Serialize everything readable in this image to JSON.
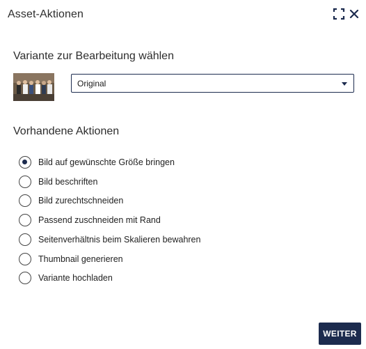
{
  "dialog": {
    "title": "Asset-Aktionen",
    "expand_icon": "expand-icon",
    "close_icon": "close-icon"
  },
  "variant_section": {
    "title": "Variante zur Bearbeitung wählen",
    "selected": "Original",
    "thumbnail_icon": "photo-thumbnail"
  },
  "actions_section": {
    "title": "Vorhandene Aktionen",
    "options": [
      {
        "label": "Bild auf gewünschte Größe bringen",
        "selected": true
      },
      {
        "label": "Bild beschriften",
        "selected": false
      },
      {
        "label": "Bild zurechtschneiden",
        "selected": false
      },
      {
        "label": "Passend zuschneiden mit Rand",
        "selected": false
      },
      {
        "label": "Seitenverhältnis beim Skalieren bewahren",
        "selected": false
      },
      {
        "label": "Thumbnail generieren",
        "selected": false
      },
      {
        "label": "Variante hochladen",
        "selected": false
      }
    ]
  },
  "footer": {
    "next_label": "WEITER"
  },
  "colors": {
    "accent": "#1c2b4e",
    "text": "#222222",
    "background": "#ffffff"
  }
}
